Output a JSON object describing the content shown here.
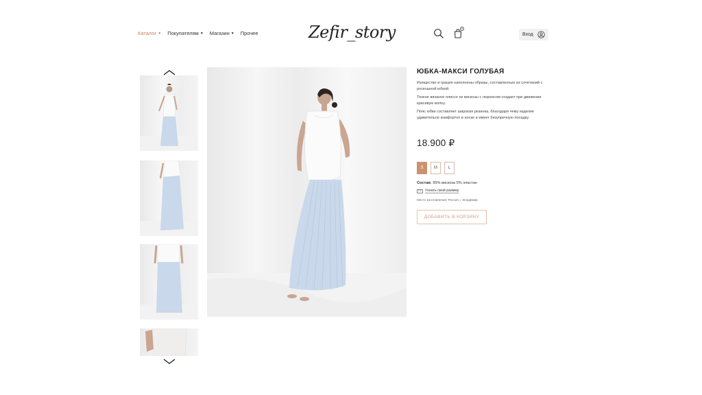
{
  "header": {
    "nav": [
      {
        "label": "Каталог",
        "active": true
      },
      {
        "label": "Покупателям",
        "active": false
      },
      {
        "label": "Магазин",
        "active": false
      },
      {
        "label": "Прочее",
        "active": false
      }
    ],
    "logo": "Zefir_story",
    "cart_count": "0",
    "login_label": "Вход",
    "icons": [
      "search-icon",
      "cart-icon",
      "user-icon"
    ]
  },
  "gallery": {
    "thumbnail_count": 4,
    "icons": [
      "chevron-up-icon",
      "chevron-down-icon"
    ]
  },
  "product": {
    "title": "ЮБКА-МАКСИ ГОЛУБАЯ",
    "description": [
      "Изящество и грация наполнены образы, составленные из сочетаний с роскошной юбкой.",
      "Тонкое вязаное плиссе из вискозы с люрексом создает при движении красивую волну.",
      "Пояс юбки составляет широкая резинка, благодаря чему изделие удивительно комфортно в носке и имеет безупречную посадку."
    ],
    "price": "18.900 ₽",
    "sizes": [
      "S",
      "M",
      "L"
    ],
    "selected_size": "S",
    "composition_label": "Состав:",
    "composition_value": "95% вискоза 5% эластан",
    "size_link": "Узнать свой размер",
    "origin": "Место изготовления: Россия, г. Владимир",
    "add_to_cart": "ДОБАВИТЬ В КОРЗИНУ"
  },
  "colors": {
    "accent": "#c9835a",
    "size_selected": "#c9936f",
    "button_text": "#d49a78",
    "skirt": "#c9d8ea"
  }
}
